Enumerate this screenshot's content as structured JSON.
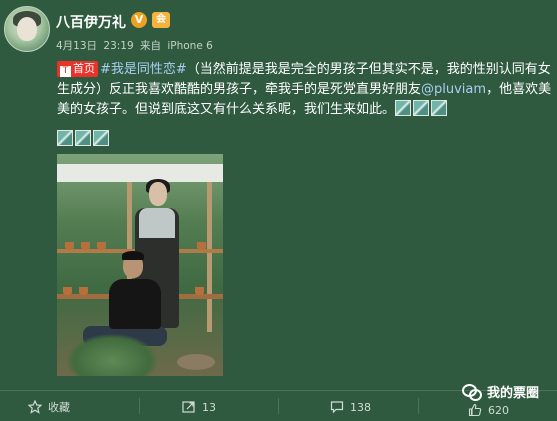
{
  "post": {
    "username": "八百伊万礼",
    "verified_mark": "V",
    "member_mark": "会",
    "meta": {
      "date": "4月13日",
      "time": "23:19",
      "source_prefix": "来自",
      "source": "iPhone 6"
    },
    "homepage_tag": "首页",
    "text": {
      "hashtag": "#我是同性恋#",
      "part1": "（当然前提是我是完全的男孩子但其实不是，我的性别认同有女生成分）反正我喜欢酷酷的男孩子，牵我手的是死党直男好朋友",
      "mention": "@pluviam",
      "part2": "，他喜欢美美的女孩子。但说到底这又有什么关系呢，我们生来如此。"
    }
  },
  "actions": {
    "collect_label": "收藏",
    "repost_count": "13",
    "comment_count": "138",
    "like_count": "620"
  },
  "watermark": {
    "text": "我的票圈"
  },
  "colors": {
    "background": "#2f5a40",
    "link": "#a9cff0",
    "homepage_tag": "#e8332b",
    "verified": "#f0a020"
  },
  "icons": [
    "star-icon",
    "repost-icon",
    "comment-icon",
    "like-icon",
    "wechat-logo"
  ]
}
